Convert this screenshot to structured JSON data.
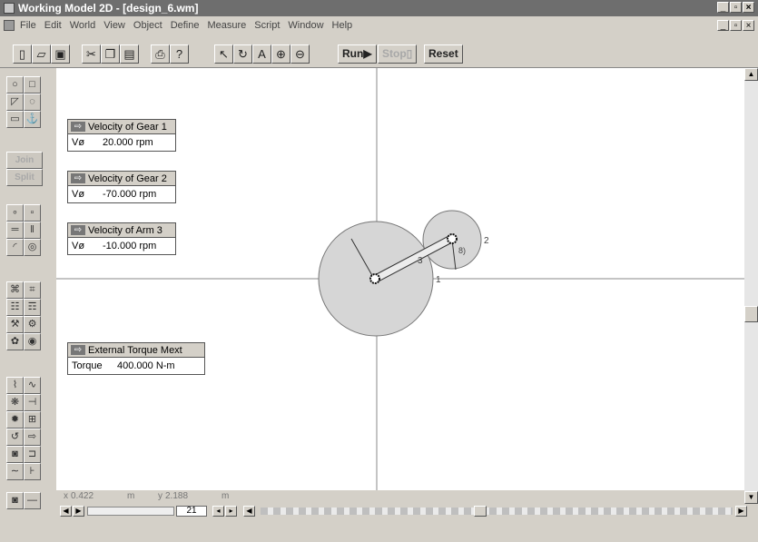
{
  "window": {
    "title": "Working Model 2D - [design_6.wm]"
  },
  "menu": [
    "File",
    "Edit",
    "World",
    "View",
    "Object",
    "Define",
    "Measure",
    "Script",
    "Window",
    "Help"
  ],
  "toolbar": {
    "icons": [
      "new-file-icon",
      "open-icon",
      "save-icon",
      "cut-icon",
      "copy-icon",
      "paste-icon",
      "print-icon",
      "help-icon",
      "pointer-icon",
      "rotate-icon",
      "text-icon",
      "zoom-in-icon",
      "zoom-out-icon"
    ],
    "run_label": "Run▶",
    "stop_label": "Stop▯",
    "reset_label": "Reset"
  },
  "palette": {
    "join_label": "Join",
    "split_label": "Split"
  },
  "meters": [
    {
      "title": "Velocity of Gear 1",
      "label": "Vø",
      "value": "20.000 rpm"
    },
    {
      "title": "Velocity of Gear 2",
      "label": "Vø",
      "value": "-70.000 rpm"
    },
    {
      "title": "Velocity of Arm 3",
      "label": "Vø",
      "value": "-10.000 rpm"
    },
    {
      "title": "External Torque Mext",
      "label": "Torque",
      "value": "400.000 N-m"
    }
  ],
  "model": {
    "labels": {
      "gear1": "1",
      "gear2": "2",
      "arm": "3",
      "pin": "8)"
    }
  },
  "status": {
    "x_label": "x",
    "x_value": "0.422",
    "x_unit": "m",
    "y_label": "y",
    "y_value": "2.188",
    "y_unit": "m"
  },
  "playback": {
    "frame": "21"
  }
}
